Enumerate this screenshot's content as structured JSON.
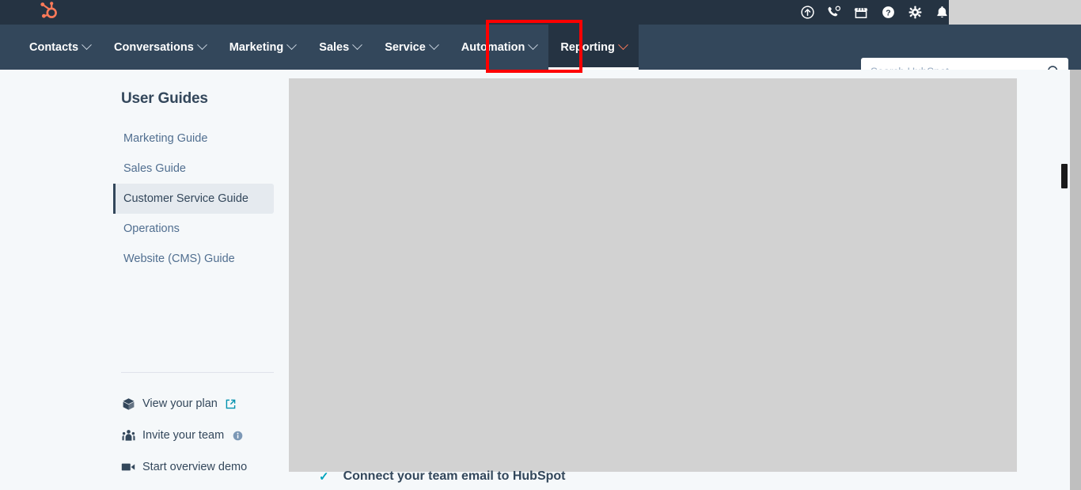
{
  "topbar": {
    "logo_icon": "hubspot-sprocket-logo",
    "icons": [
      {
        "name": "upgrade-icon",
        "title": "Upgrade"
      },
      {
        "name": "calling-icon",
        "title": "Calling"
      },
      {
        "name": "marketplace-icon",
        "title": "Marketplace"
      },
      {
        "name": "help-icon",
        "title": "Help"
      },
      {
        "name": "settings-gear-icon",
        "title": "Settings"
      },
      {
        "name": "notifications-bell-icon",
        "title": "Notifications"
      }
    ]
  },
  "nav": {
    "items": [
      {
        "label": "Contacts",
        "active": false
      },
      {
        "label": "Conversations",
        "active": false
      },
      {
        "label": "Marketing",
        "active": false
      },
      {
        "label": "Sales",
        "active": false
      },
      {
        "label": "Service",
        "active": false
      },
      {
        "label": "Automation",
        "active": false
      },
      {
        "label": "Reporting",
        "active": true
      }
    ],
    "active_label": "Reporting",
    "chevron_icon": "chevron-down-icon",
    "active_accent_color": "#ff7a59"
  },
  "annotation": {
    "target": "Reporting",
    "color": "#ff0000"
  },
  "search": {
    "placeholder": "Search HubSpot",
    "value": "",
    "icon": "search-icon"
  },
  "sidebar": {
    "title": "User Guides",
    "items": [
      {
        "label": "Marketing Guide",
        "selected": false
      },
      {
        "label": "Sales Guide",
        "selected": false
      },
      {
        "label": "Customer Service Guide",
        "selected": true
      },
      {
        "label": "Operations",
        "selected": false
      },
      {
        "label": "Website (CMS) Guide",
        "selected": false
      }
    ],
    "links": [
      {
        "label": "View your plan",
        "lead_icon": "box-cube-icon",
        "trail_icon": "external-link-icon"
      },
      {
        "label": "Invite your team",
        "lead_icon": "users-group-icon",
        "trail_icon": "info-circle-icon"
      },
      {
        "label": "Start overview demo",
        "lead_icon": "video-camera-icon",
        "trail_icon": ""
      }
    ]
  },
  "content": {
    "checklist_item": "Connect your team email to HubSpot",
    "check_icon": "checkmark-icon"
  },
  "colors": {
    "topbar_bg": "#253342",
    "navbar_bg": "#33475b",
    "page_bg": "#f5f8fa",
    "brand_orange": "#ff7a59",
    "selected_item_bg": "#e5eaef",
    "teal": "#00a4bd"
  }
}
